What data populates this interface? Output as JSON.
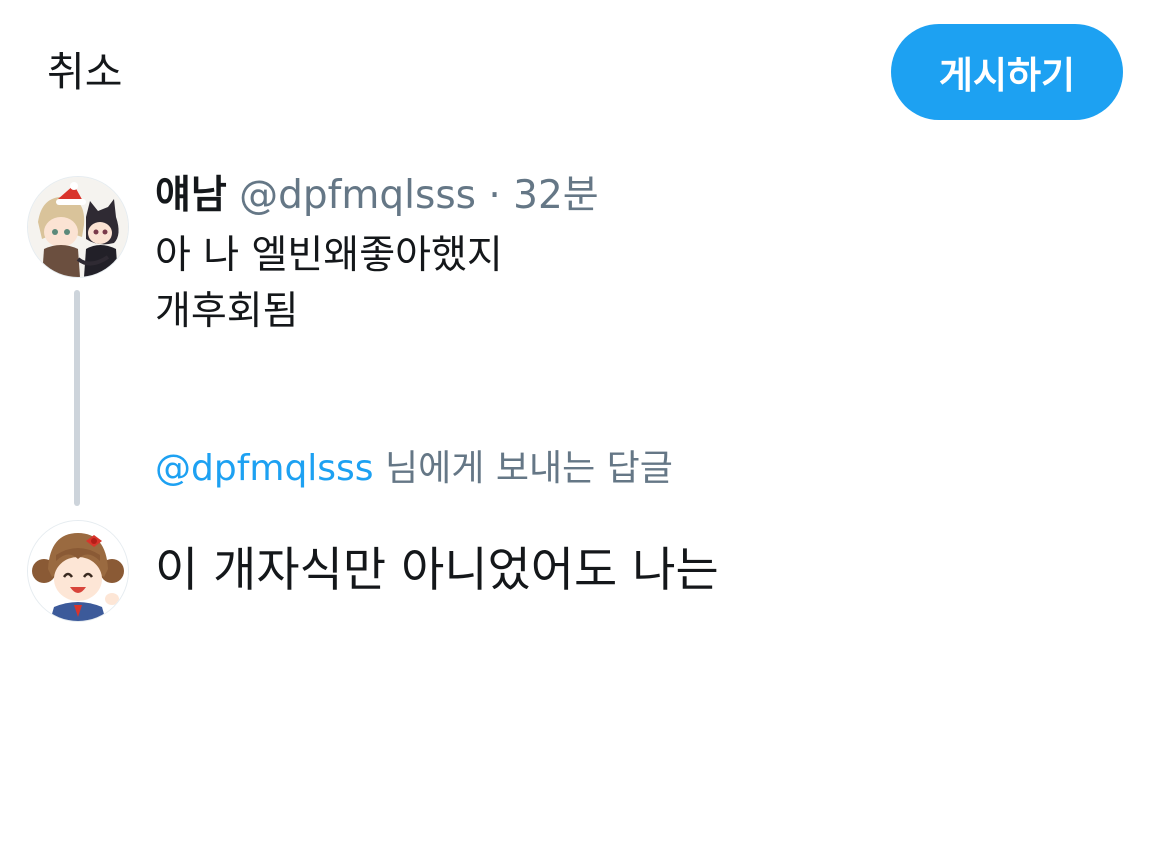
{
  "header": {
    "cancel_label": "취소",
    "post_label": "게시하기",
    "accent_color": "#1da1f2"
  },
  "tweet": {
    "display_name": "얘남",
    "handle": "@dpfmqlsss",
    "separator": "·",
    "time": "32분",
    "lines": [
      "아 나 엘빈왜좋아했지",
      "개후회됨"
    ],
    "avatar_icon": "chibi-characters-avatar"
  },
  "reply": {
    "mention": "@dpfmqlsss",
    "suffix": "님에게 보내는 답글"
  },
  "compose": {
    "text": "이 개자식만 아니었어도 나는",
    "avatar_icon": "chibi-girl-avatar"
  }
}
